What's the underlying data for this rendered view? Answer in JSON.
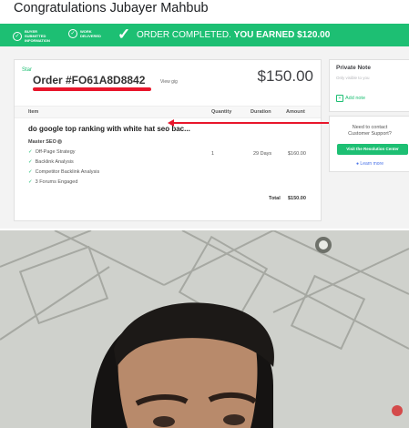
{
  "post": {
    "title": "Congratulations Jubayer Mahbub"
  },
  "banner": {
    "steps": [
      "BUYER SUBMITTED INFORMATION",
      "WORK DELIVERED"
    ],
    "check_icon": "checkmark-icon",
    "message_prefix": "ORDER COMPLETED.",
    "message_bold": "YOU EARNED $120.00",
    "color": "#1dbf73"
  },
  "order": {
    "star_label": "Star",
    "order_number": "Order #FO61A8D8842",
    "view_gig": "View gig",
    "price": "$150.00",
    "columns": [
      "Item",
      "Quantity",
      "Duration",
      "Amount"
    ],
    "gig_title": "do google top ranking with white hat seo bac...",
    "package": "Master SEO",
    "features": [
      "Off-Page Strategy",
      "Backlink Analysis",
      "Competitor Backlink Analysis",
      "3 Forums Engaged"
    ],
    "quantity": "1",
    "duration": "29 Days",
    "amount": "$160.00",
    "total_label": "Total",
    "total_value": "$150.00"
  },
  "private_note": {
    "heading": "Private Note",
    "subtext": "Only visible to you",
    "add_label": "Add note"
  },
  "support": {
    "question_line1": "Need to contact",
    "question_line2": "Customer Support?",
    "button_label": "Visit the Resolution Center",
    "learn_more": "Learn more"
  },
  "annotation_color": "#e8162b"
}
